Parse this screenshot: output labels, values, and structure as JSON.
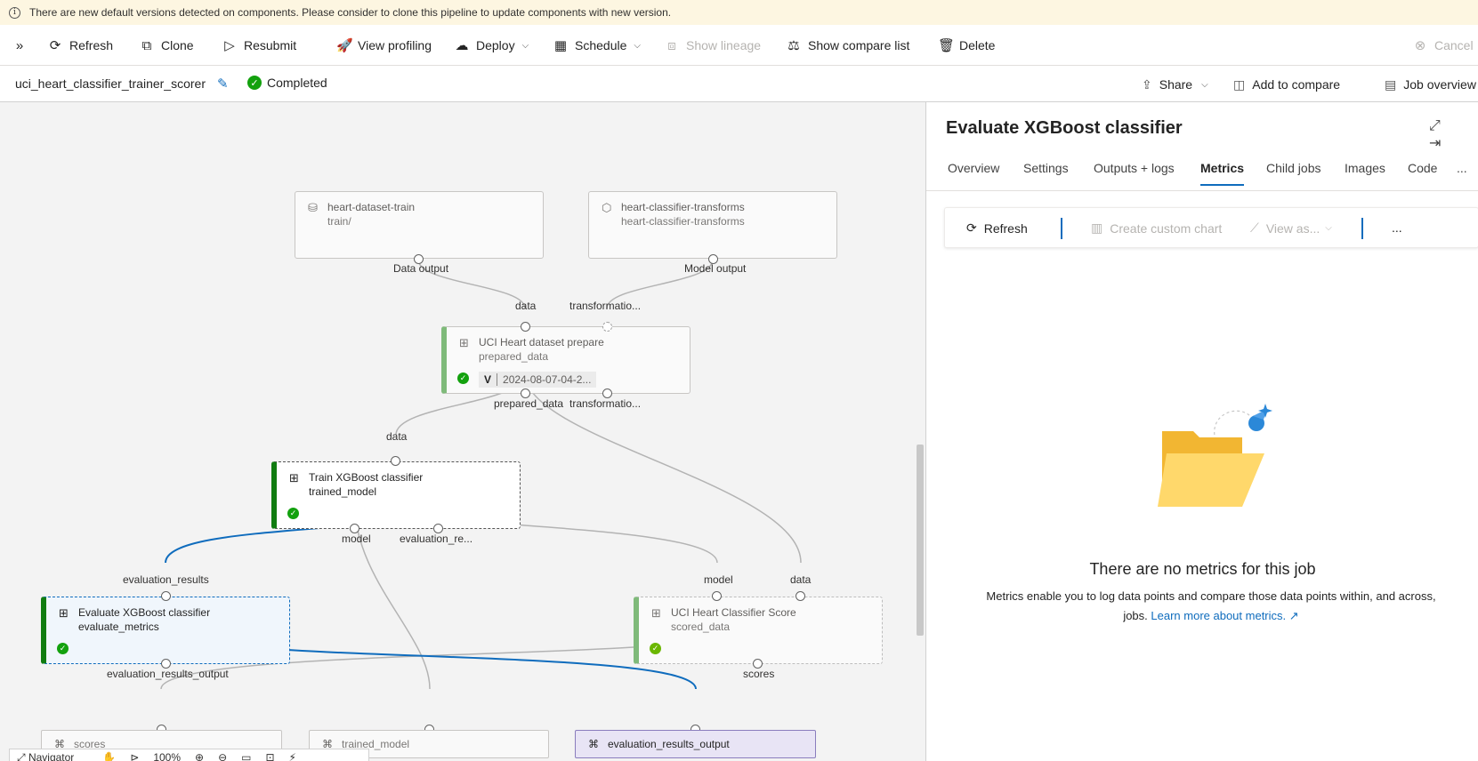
{
  "banner": {
    "text": "There are new default versions detected on components. Please consider to clone this pipeline to update components with new version."
  },
  "toolbar": {
    "refresh": "Refresh",
    "clone": "Clone",
    "resubmit": "Resubmit",
    "view_profiling": "View profiling",
    "deploy": "Deploy",
    "schedule": "Schedule",
    "show_lineage": "Show lineage",
    "show_compare_list": "Show compare list",
    "delete": "Delete",
    "cancel": "Cancel"
  },
  "job": {
    "name": "uci_heart_classifier_trainer_scorer",
    "status": "Completed",
    "share": "Share",
    "add_to_compare": "Add to compare",
    "job_overview": "Job overview"
  },
  "graph": {
    "dataset_node": {
      "title": "heart-dataset-train",
      "sub": "train/",
      "port_label": "Data output"
    },
    "transforms_node": {
      "title": "heart-classifier-transforms",
      "sub": "heart-classifier-transforms",
      "port_label": "Model output"
    },
    "prepare_node": {
      "title": "UCI Heart dataset prepare",
      "sub": "prepared_data",
      "version_letter": "V",
      "version": "2024-08-07-04-2...",
      "in_data": "data",
      "in_transform": "transformatio...",
      "out_prepared": "prepared_data",
      "out_transform": "transformatio..."
    },
    "train_node": {
      "title": "Train XGBoost classifier",
      "sub": "trained_model",
      "in_data": "data",
      "out_model": "model",
      "out_eval": "evaluation_re..."
    },
    "evaluate_node": {
      "title": "Evaluate XGBoost classifier",
      "sub": "evaluate_metrics",
      "in_eval": "evaluation_results",
      "out_eval": "evaluation_results_output"
    },
    "score_node": {
      "title": "UCI Heart Classifier Score",
      "sub": "scored_data",
      "in_model": "model",
      "in_data": "data",
      "out_scores": "scores"
    },
    "outputs": {
      "scores": "scores",
      "trained_model": "trained_model",
      "evaluation_results_output": "evaluation_results_output"
    },
    "navigator": {
      "label": "Navigator",
      "zoom": "100%"
    }
  },
  "panel": {
    "title": "Evaluate XGBoost classifier",
    "tabs": [
      "Overview",
      "Settings",
      "Outputs + logs",
      "Metrics",
      "Child jobs",
      "Images",
      "Code"
    ],
    "active_tab": "Metrics",
    "more": "...",
    "metrics_toolbar": {
      "refresh": "Refresh",
      "create_custom_chart": "Create custom chart",
      "view_as": "View as...",
      "more": "..."
    },
    "empty": {
      "title": "There are no metrics for this job",
      "desc": "Metrics enable you to log data points and compare those data points within, and across, jobs.",
      "link": "Learn more about metrics."
    }
  },
  "colors": {
    "accent": "#0f6cbd",
    "success": "#13a10e",
    "banner_bg": "#fdf6e1",
    "highlight_output": "#e8e4f5"
  }
}
